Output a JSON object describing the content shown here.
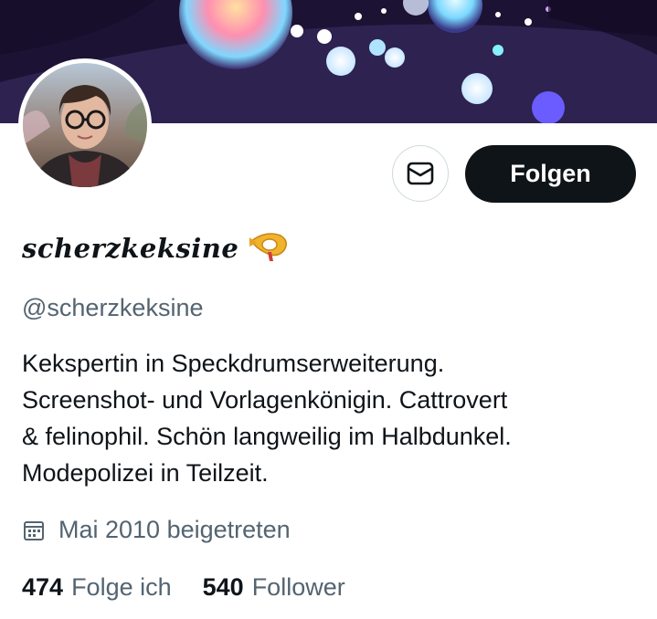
{
  "profile": {
    "display_name": "scherzkeksine",
    "display_name_emoji": "postal-horn-icon",
    "handle": "@scherzkeksine",
    "bio_lines": [
      "Kekspertin in Speckdrumserweiterung.",
      "Screenshot- und Vorlagenkönigin. Cattrovert",
      "& felinophil. Schön langweilig im Halbdunkel.",
      "Modepolizei in Teilzeit."
    ],
    "joined": "Mai 2010 beigetreten"
  },
  "actions": {
    "message_icon": "envelope-icon",
    "follow_label": "Folgen"
  },
  "stats": {
    "following_count": "474",
    "following_label": "Folge ich",
    "followers_count": "540",
    "followers_label": "Follower"
  },
  "colors": {
    "text_primary": "#0f1419",
    "text_secondary": "#536471",
    "follow_button_bg": "#0f1419",
    "border": "#cfd9de"
  }
}
